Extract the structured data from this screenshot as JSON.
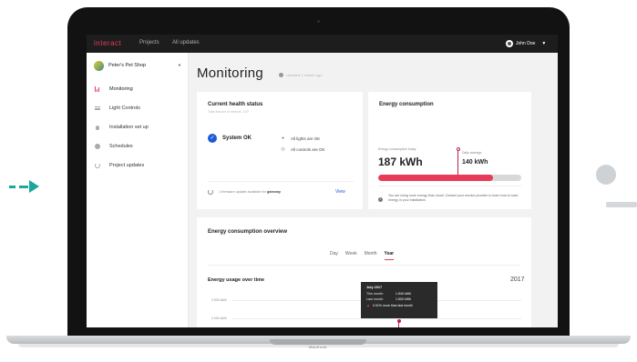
{
  "topbar": {
    "brand": "interact",
    "nav": [
      "Projects",
      "All updates"
    ],
    "user": "John Doe"
  },
  "sidebar": {
    "shop_name": "Peter's Pet Shop",
    "items": [
      {
        "label": "Monitoring",
        "icon": "bar-chart-icon",
        "active": true
      },
      {
        "label": "Light Controls",
        "icon": "sliders-icon"
      },
      {
        "label": "Installation set up",
        "icon": "bulb-icon"
      },
      {
        "label": "Schedules",
        "icon": "clock-icon"
      },
      {
        "label": "Project updates",
        "icon": "refresh-icon"
      }
    ]
  },
  "main": {
    "title": "Monitoring",
    "updated": "Updated 1 minute ago"
  },
  "health": {
    "title": "Current health status",
    "subtitle": "Total amount of devices: 100",
    "status": "System OK",
    "lights": "All lights are OK",
    "controls": "All controls are OK",
    "firmware_prefix": "1 firmware update available for",
    "firmware_target": "gateway",
    "view": "View"
  },
  "energy": {
    "title": "Energy consumption",
    "today_label": "Energy consumption today",
    "today_value": "187 kWh",
    "avg_label": "Daily average",
    "avg_value": "140 kWh",
    "fill_fraction": 0.8,
    "warning": "You are using more energy than usual. Contact your service provider to learn how to save energy in your installation.",
    "colors": {
      "fill": "#e83a5a",
      "marker": "#b9234a"
    }
  },
  "overview": {
    "title": "Energy consumption overview",
    "tabs": [
      "Day",
      "Week",
      "Month",
      "Year"
    ],
    "active_tab": "Year",
    "chart_title": "Energy usage over time",
    "year": "2017",
    "ticks": [
      "2.500 kWh",
      "2.000 kWh"
    ],
    "tooltip": {
      "title": "July 2017",
      "this_month_label": "This month:",
      "this_month_value": "1.540 kWh",
      "last_month_label": "Last month:",
      "last_month_value": "1.500 kWh",
      "note": "0.01% more than last month"
    }
  },
  "laptop": {
    "label": "Macbook"
  }
}
